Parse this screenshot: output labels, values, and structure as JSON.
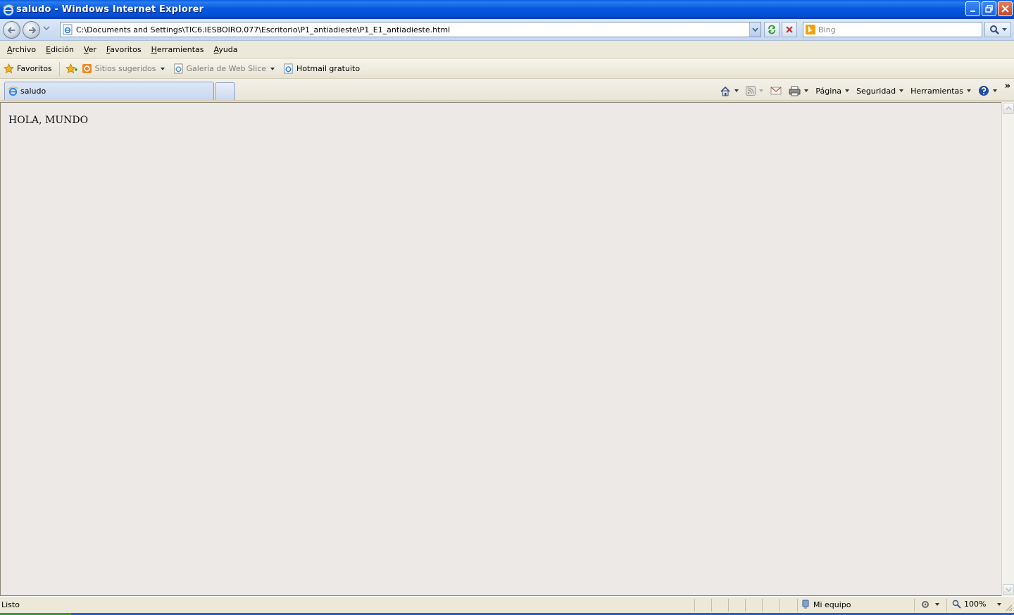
{
  "window": {
    "title": "saludo - Windows Internet Explorer"
  },
  "address_bar": {
    "url": "C:\\Documents and Settings\\TIC6.IESBOIRO.077\\Escritorio\\P1_antiadieste\\P1_E1_antiadieste.html"
  },
  "search": {
    "placeholder": "Bing"
  },
  "menu": {
    "items": [
      {
        "first": "A",
        "rest": "rchivo"
      },
      {
        "first": "E",
        "rest": "dición"
      },
      {
        "first": "V",
        "rest": "er"
      },
      {
        "first": "F",
        "rest": "avoritos"
      },
      {
        "first": "H",
        "rest": "erramientas"
      },
      {
        "first": "A",
        "rest": "yuda"
      }
    ]
  },
  "favorites_bar": {
    "favorites_label": "Favoritos",
    "links": [
      "Sitios sugeridos",
      "Galería de Web Slice",
      "Hotmail gratuito"
    ]
  },
  "tabs": {
    "active_label": "saludo"
  },
  "command_bar": {
    "page_label": "Página",
    "security_label": "Seguridad",
    "tools_label": "Herramientas"
  },
  "document": {
    "text": "HOLA, MUNDO"
  },
  "status_bar": {
    "status": "Listo",
    "zone": "Mi equipo",
    "zoom": "100%"
  },
  "colors": {
    "titlebar": "#0858de",
    "chrome": "#ece9d8",
    "content_bg": "#ece9e6"
  }
}
